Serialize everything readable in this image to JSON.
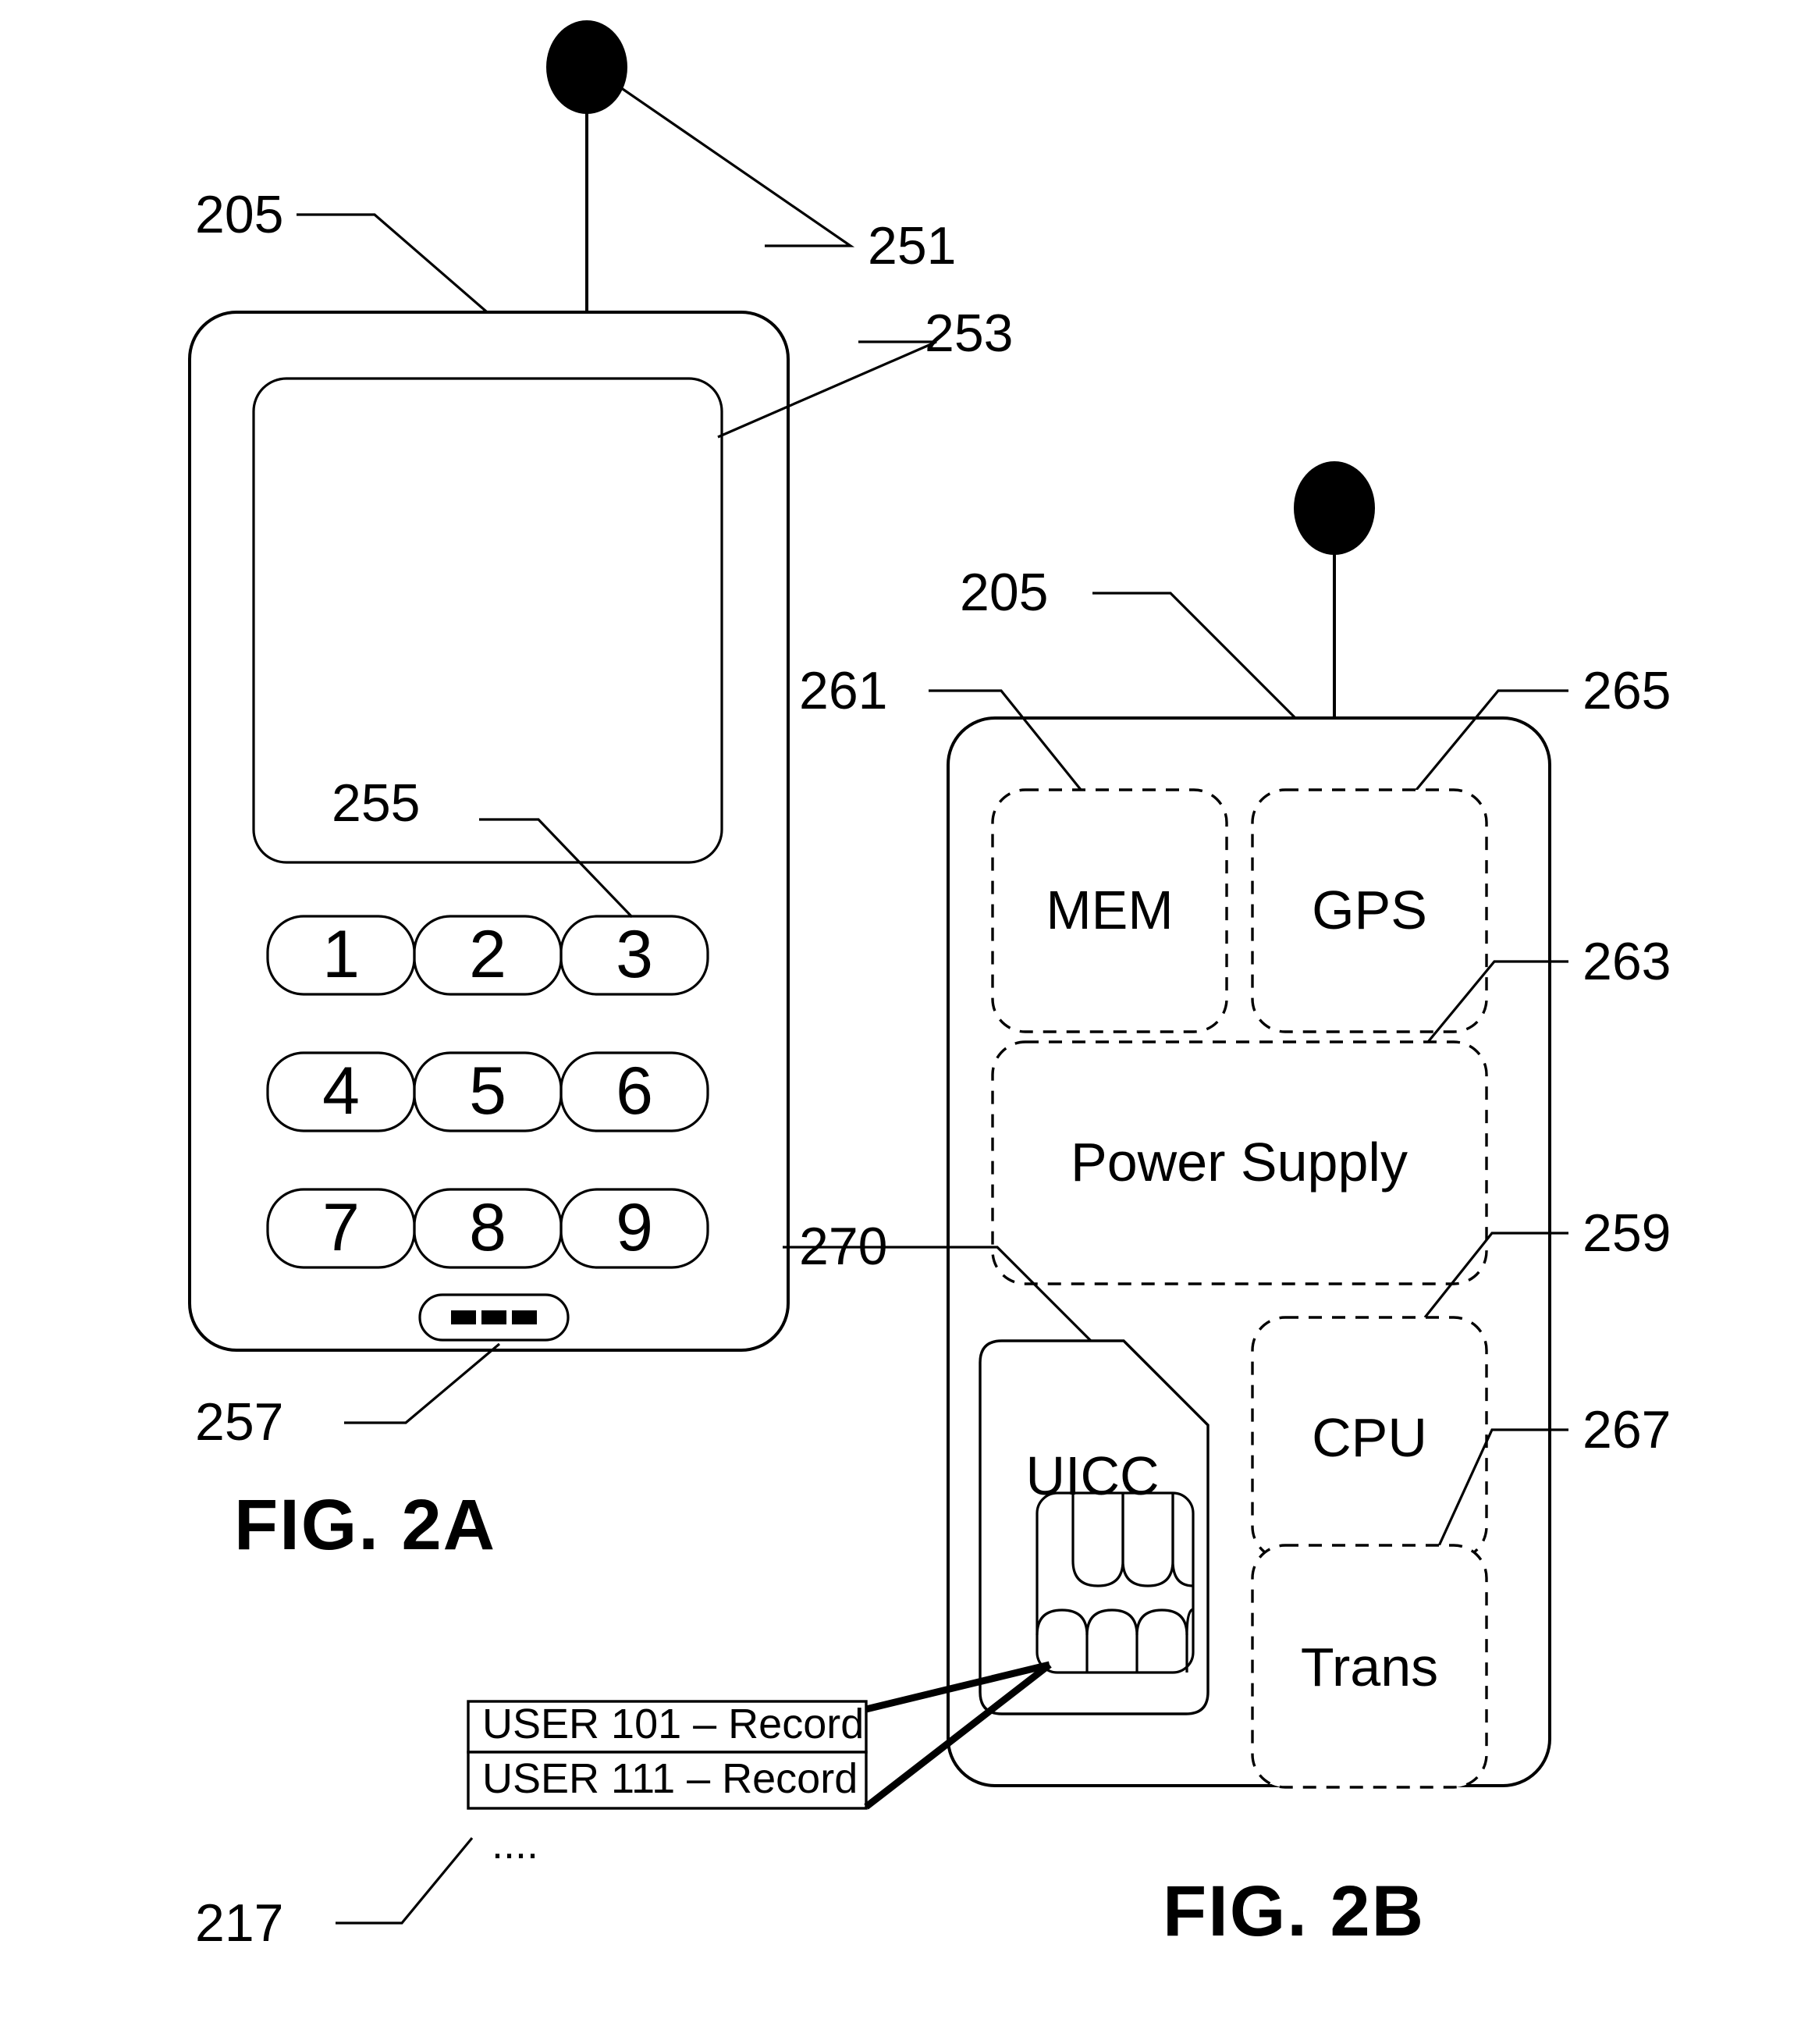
{
  "document": {
    "kind": "patent-figure-sheet",
    "figures": [
      {
        "id": "fig-2a",
        "caption": "FIG. 2A",
        "title_device": "mobile handset exterior view"
      },
      {
        "id": "fig-2b",
        "caption": "FIG. 2B",
        "title_device": "mobile handset internal component view"
      }
    ]
  },
  "fig_2a": {
    "caption": "FIG. 2A",
    "reference_numerals": {
      "device_body": "205",
      "antenna": "251",
      "display_screen": "253",
      "keypad": "255",
      "function_key": "257"
    },
    "keypad": {
      "rows": [
        [
          "1",
          "2",
          "3"
        ],
        [
          "4",
          "5",
          "6"
        ],
        [
          "7",
          "8",
          "9"
        ]
      ],
      "function_key_glyph": "---"
    }
  },
  "fig_2b": {
    "caption": "FIG. 2B",
    "reference_numerals": {
      "device_body": "205",
      "memory": "261",
      "gps": "265",
      "power_supply": "263",
      "cpu": "259",
      "transceiver": "267",
      "uicc": "270",
      "record_table": "217"
    },
    "blocks": [
      {
        "key": "mem",
        "label": "MEM",
        "style": "dashed"
      },
      {
        "key": "gps",
        "label": "GPS",
        "style": "dashed"
      },
      {
        "key": "power_supply",
        "label": "Power Supply",
        "style": "dashed"
      },
      {
        "key": "uicc",
        "label": "UICC",
        "style": "solid-sim-card"
      },
      {
        "key": "cpu",
        "label": "CPU",
        "style": "dashed"
      },
      {
        "key": "trans",
        "label": "Trans",
        "style": "dashed"
      }
    ],
    "record_table": {
      "rows": [
        "USER 101 – Record",
        "USER 111 – Record"
      ],
      "continuation": "...."
    }
  },
  "colors": {
    "ink": "#000000",
    "paper": "#ffffff"
  }
}
